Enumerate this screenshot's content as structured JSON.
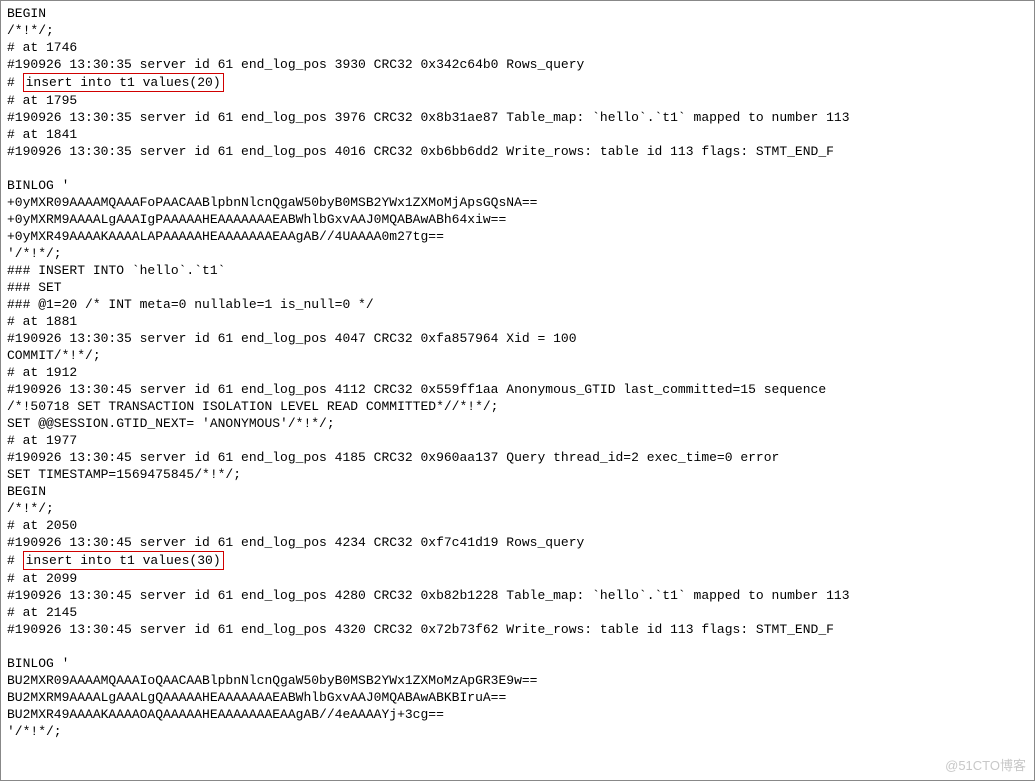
{
  "lines": {
    "l1": "BEGIN",
    "l2": "/*!*/;",
    "l3": "# at 1746",
    "l4": "#190926 13:30:35 server id 61  end_log_pos 3930 CRC32 0x342c64b0        Rows_query",
    "l5_prefix": "# ",
    "l5_box": "insert into t1 values(20)",
    "l6": "# at 1795",
    "l7": "#190926 13:30:35 server id 61  end_log_pos 3976 CRC32 0x8b31ae87        Table_map: `hello`.`t1` mapped to number 113",
    "l8": "# at 1841",
    "l9": "#190926 13:30:35 server id 61  end_log_pos 4016 CRC32 0xb6bb6dd2        Write_rows: table id 113 flags: STMT_END_F",
    "l10": "",
    "l11": "BINLOG '",
    "l12": "+0yMXR09AAAAMQAAAFoPAACAABlpbnNlcnQgaW50byB0MSB2YWx1ZXMoMjApsGQsNA==",
    "l13": "+0yMXRM9AAAALgAAAIgPAAAAAHEAAAAAAAEABWhlbGxvAAJ0MQABAwABh64xiw==",
    "l14": "+0yMXR49AAAAKAAAALAPAAAAAHEAAAAAAAEAAgAB//4UAAAA0m27tg==",
    "l15": "'/*!*/;",
    "l16": "### INSERT INTO `hello`.`t1`",
    "l17": "### SET",
    "l18": "###   @1=20 /* INT meta=0 nullable=1 is_null=0 */",
    "l19": "# at 1881",
    "l20": "#190926 13:30:35 server id 61  end_log_pos 4047 CRC32 0xfa857964        Xid = 100",
    "l21": "COMMIT/*!*/;",
    "l22": "# at 1912",
    "l23": "#190926 13:30:45 server id 61  end_log_pos 4112 CRC32 0x559ff1aa        Anonymous_GTID  last_committed=15        sequence",
    "l24": "/*!50718 SET TRANSACTION ISOLATION LEVEL READ COMMITTED*//*!*/;",
    "l25": "SET @@SESSION.GTID_NEXT= 'ANONYMOUS'/*!*/;",
    "l26": "# at 1977",
    "l27": "#190926 13:30:45 server id 61  end_log_pos 4185 CRC32 0x960aa137        Query   thread_id=2     exec_time=0     error",
    "l28": "SET TIMESTAMP=1569475845/*!*/;",
    "l29": "BEGIN",
    "l30": "/*!*/;",
    "l31": "# at 2050",
    "l32": "#190926 13:30:45 server id 61  end_log_pos 4234 CRC32 0xf7c41d19        Rows_query",
    "l33_prefix": "# ",
    "l33_box": "insert into t1 values(30)",
    "l34": "# at 2099",
    "l35": "#190926 13:30:45 server id 61  end_log_pos 4280 CRC32 0xb82b1228        Table_map: `hello`.`t1` mapped to number 113",
    "l36": "# at 2145",
    "l37": "#190926 13:30:45 server id 61  end_log_pos 4320 CRC32 0x72b73f62        Write_rows: table id 113 flags: STMT_END_F",
    "l38": "",
    "l39": "BINLOG '",
    "l40": "BU2MXR09AAAAMQAAAIoQAACAABlpbnNlcnQgaW50byB0MSB2YWx1ZXMoMzApGR3E9w==",
    "l41": "BU2MXRM9AAAALgAAALgQAAAAAHEAAAAAAAEABWhlbGxvAAJ0MQABAwABKBIruA==",
    "l42": "BU2MXR49AAAAKAAAAOAQAAAAAHEAAAAAAAEAAgAB//4eAAAAYj+3cg==",
    "l43": "'/*!*/;"
  },
  "watermark": "@51CTO博客"
}
